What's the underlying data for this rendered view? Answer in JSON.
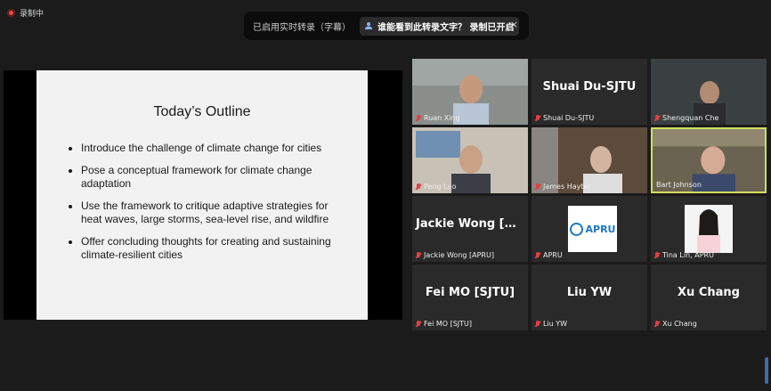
{
  "recording_badge": "录制中",
  "banner": {
    "text": "已启用实时转录（字幕）",
    "pill_text": "谁能看到此转录文字？ 录制已开启",
    "close": "×"
  },
  "slide": {
    "title": "Today’s Outline",
    "bullets": [
      "Introduce the challenge of climate change for cities",
      "Pose a conceptual framework for climate change adaptation",
      "Use the framework to critique adaptive strategies for heat waves, large storms, sea-level rise, and wildfire",
      "Offer concluding thoughts for creating and sustaining climate-resilient cities"
    ]
  },
  "participants": [
    {
      "name": "Ruan Xing",
      "big": ""
    },
    {
      "name": "Shuai Du-SJTU",
      "big": "Shuai Du-SJTU"
    },
    {
      "name": "Shengquan Che",
      "big": ""
    },
    {
      "name": "Peng Luo",
      "big": ""
    },
    {
      "name": "James Hayter",
      "big": ""
    },
    {
      "name": "Bart Johnson",
      "big": ""
    },
    {
      "name": "Jackie Wong [APRU]",
      "big": "Jackie Wong [A..."
    },
    {
      "name": "APRU",
      "big": ""
    },
    {
      "name": "Tina Lin, APRU",
      "big": ""
    },
    {
      "name": "Fei MO [SJTU]",
      "big": "Fei MO [SJTU]"
    },
    {
      "name": "Liu YW",
      "big": "Liu YW"
    },
    {
      "name": "Xu Chang",
      "big": "Xu Chang"
    }
  ],
  "apru_logo": "APRU"
}
